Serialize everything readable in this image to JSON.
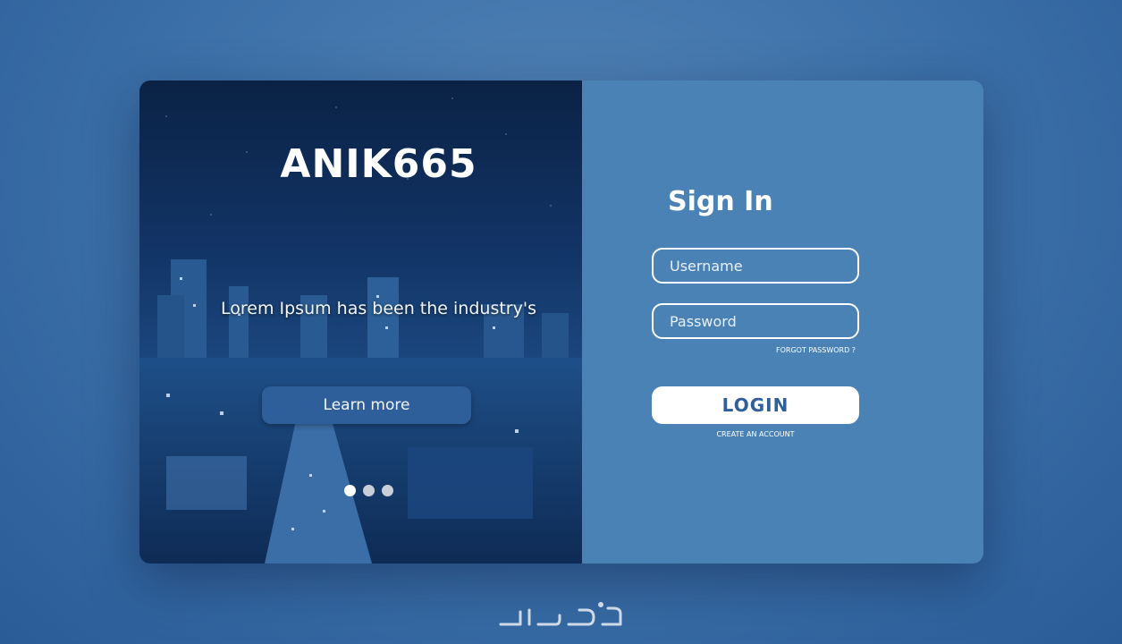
{
  "hero": {
    "title": "ANIK665",
    "tagline": "Lorem Ipsum has been the industry's",
    "learn_more_label": "Learn more",
    "slides": [
      {
        "active": true
      },
      {
        "active": false
      },
      {
        "active": false
      }
    ]
  },
  "signin": {
    "title": "Sign In",
    "username_placeholder": "Username",
    "password_placeholder": "Password",
    "forgot_label": "FORGOT PASSWORD ?",
    "login_label": "LOGIN",
    "create_account_label": "CREATE AN ACCOUNT"
  },
  "watermark": {
    "text": "خمسات"
  },
  "colors": {
    "background": "#3f73aa",
    "panel": "#4a82b5",
    "button_dark": "#2f5f9b",
    "login_text": "#2f5f9b",
    "white": "#ffffff"
  }
}
